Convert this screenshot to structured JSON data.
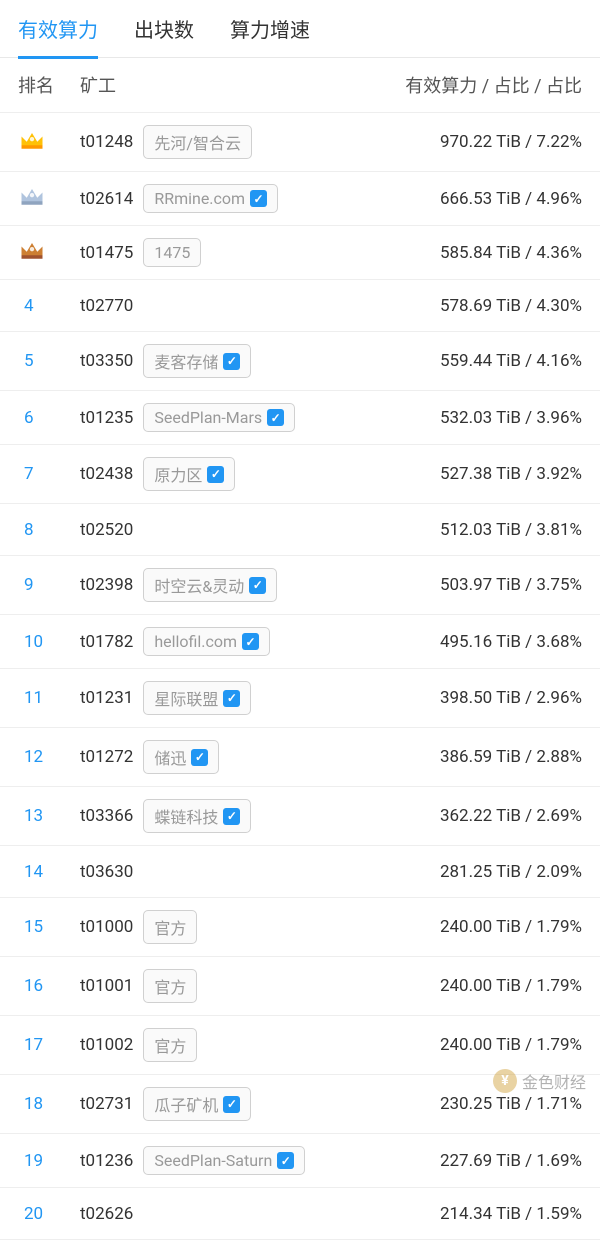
{
  "tabs": {
    "effective_power": "有效算力",
    "block_count": "出块数",
    "power_growth": "算力增速"
  },
  "header": {
    "rank": "排名",
    "miner": "矿工",
    "value": "有效算力 / 占比 / 占比"
  },
  "rows": [
    {
      "rank": 1,
      "crown": "gold",
      "miner_id": "t01248",
      "tag": "先河/智合云",
      "verified": false,
      "value": "970.22 TiB / 7.22%"
    },
    {
      "rank": 2,
      "crown": "silver",
      "miner_id": "t02614",
      "tag": "RRmine.com",
      "verified": true,
      "value": "666.53 TiB / 4.96%"
    },
    {
      "rank": 3,
      "crown": "bronze",
      "miner_id": "t01475",
      "tag": "1475",
      "verified": false,
      "value": "585.84 TiB / 4.36%"
    },
    {
      "rank": 4,
      "crown": null,
      "miner_id": "t02770",
      "tag": null,
      "verified": false,
      "value": "578.69 TiB / 4.30%"
    },
    {
      "rank": 5,
      "crown": null,
      "miner_id": "t03350",
      "tag": "麦客存储",
      "verified": true,
      "value": "559.44 TiB / 4.16%"
    },
    {
      "rank": 6,
      "crown": null,
      "miner_id": "t01235",
      "tag": "SeedPlan-Mars",
      "verified": true,
      "value": "532.03 TiB / 3.96%"
    },
    {
      "rank": 7,
      "crown": null,
      "miner_id": "t02438",
      "tag": "原力区",
      "verified": true,
      "value": "527.38 TiB / 3.92%"
    },
    {
      "rank": 8,
      "crown": null,
      "miner_id": "t02520",
      "tag": null,
      "verified": false,
      "value": "512.03 TiB / 3.81%"
    },
    {
      "rank": 9,
      "crown": null,
      "miner_id": "t02398",
      "tag": "时空云&灵动",
      "verified": true,
      "value": "503.97 TiB / 3.75%"
    },
    {
      "rank": 10,
      "crown": null,
      "miner_id": "t01782",
      "tag": "hellofil.com",
      "verified": true,
      "value": "495.16 TiB / 3.68%"
    },
    {
      "rank": 11,
      "crown": null,
      "miner_id": "t01231",
      "tag": "星际联盟",
      "verified": true,
      "value": "398.50 TiB / 2.96%"
    },
    {
      "rank": 12,
      "crown": null,
      "miner_id": "t01272",
      "tag": "储迅",
      "verified": true,
      "value": "386.59 TiB / 2.88%"
    },
    {
      "rank": 13,
      "crown": null,
      "miner_id": "t03366",
      "tag": "蝶链科技",
      "verified": true,
      "value": "362.22 TiB / 2.69%"
    },
    {
      "rank": 14,
      "crown": null,
      "miner_id": "t03630",
      "tag": null,
      "verified": false,
      "value": "281.25 TiB / 2.09%"
    },
    {
      "rank": 15,
      "crown": null,
      "miner_id": "t01000",
      "tag": "官方",
      "verified": false,
      "value": "240.00 TiB / 1.79%"
    },
    {
      "rank": 16,
      "crown": null,
      "miner_id": "t01001",
      "tag": "官方",
      "verified": false,
      "value": "240.00 TiB / 1.79%"
    },
    {
      "rank": 17,
      "crown": null,
      "miner_id": "t01002",
      "tag": "官方",
      "verified": false,
      "value": "240.00 TiB / 1.79%"
    },
    {
      "rank": 18,
      "crown": null,
      "miner_id": "t02731",
      "tag": "瓜子矿机",
      "verified": true,
      "value": "230.25 TiB / 1.71%"
    },
    {
      "rank": 19,
      "crown": null,
      "miner_id": "t01236",
      "tag": "SeedPlan-Saturn",
      "verified": true,
      "value": "227.69 TiB / 1.69%"
    },
    {
      "rank": 20,
      "crown": null,
      "miner_id": "t02626",
      "tag": null,
      "verified": false,
      "value": "214.34 TiB / 1.59%"
    }
  ],
  "watermark": "金色财经"
}
